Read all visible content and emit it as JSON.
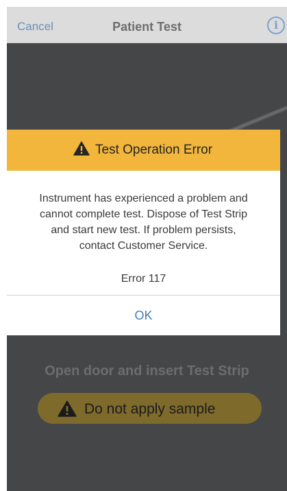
{
  "nav": {
    "cancel_label": "Cancel",
    "title": "Patient Test",
    "info_glyph": "i"
  },
  "screen": {
    "instruction": "Open door and insert Test Strip",
    "warning_pill": {
      "icon": "warning-triangle-icon",
      "label": "Do not apply sample"
    }
  },
  "dialog": {
    "header": {
      "icon": "warning-triangle-icon",
      "title": "Test Operation Error"
    },
    "message_lines": [
      "Instrument has experienced a problem and",
      "cannot complete test. Dispose of Test Strip",
      "and start new test. If problem persists,",
      "contact Customer Service."
    ],
    "error_code": "Error 117",
    "ok_label": "OK"
  },
  "colors": {
    "nav_bg": "#dcdcdc",
    "link_blue": "#6a8fb8",
    "screen_bg": "#444648",
    "dialog_header": "#f2b63c",
    "pill_bg": "#7e6a2b",
    "ok_blue": "#3f7cc2"
  }
}
